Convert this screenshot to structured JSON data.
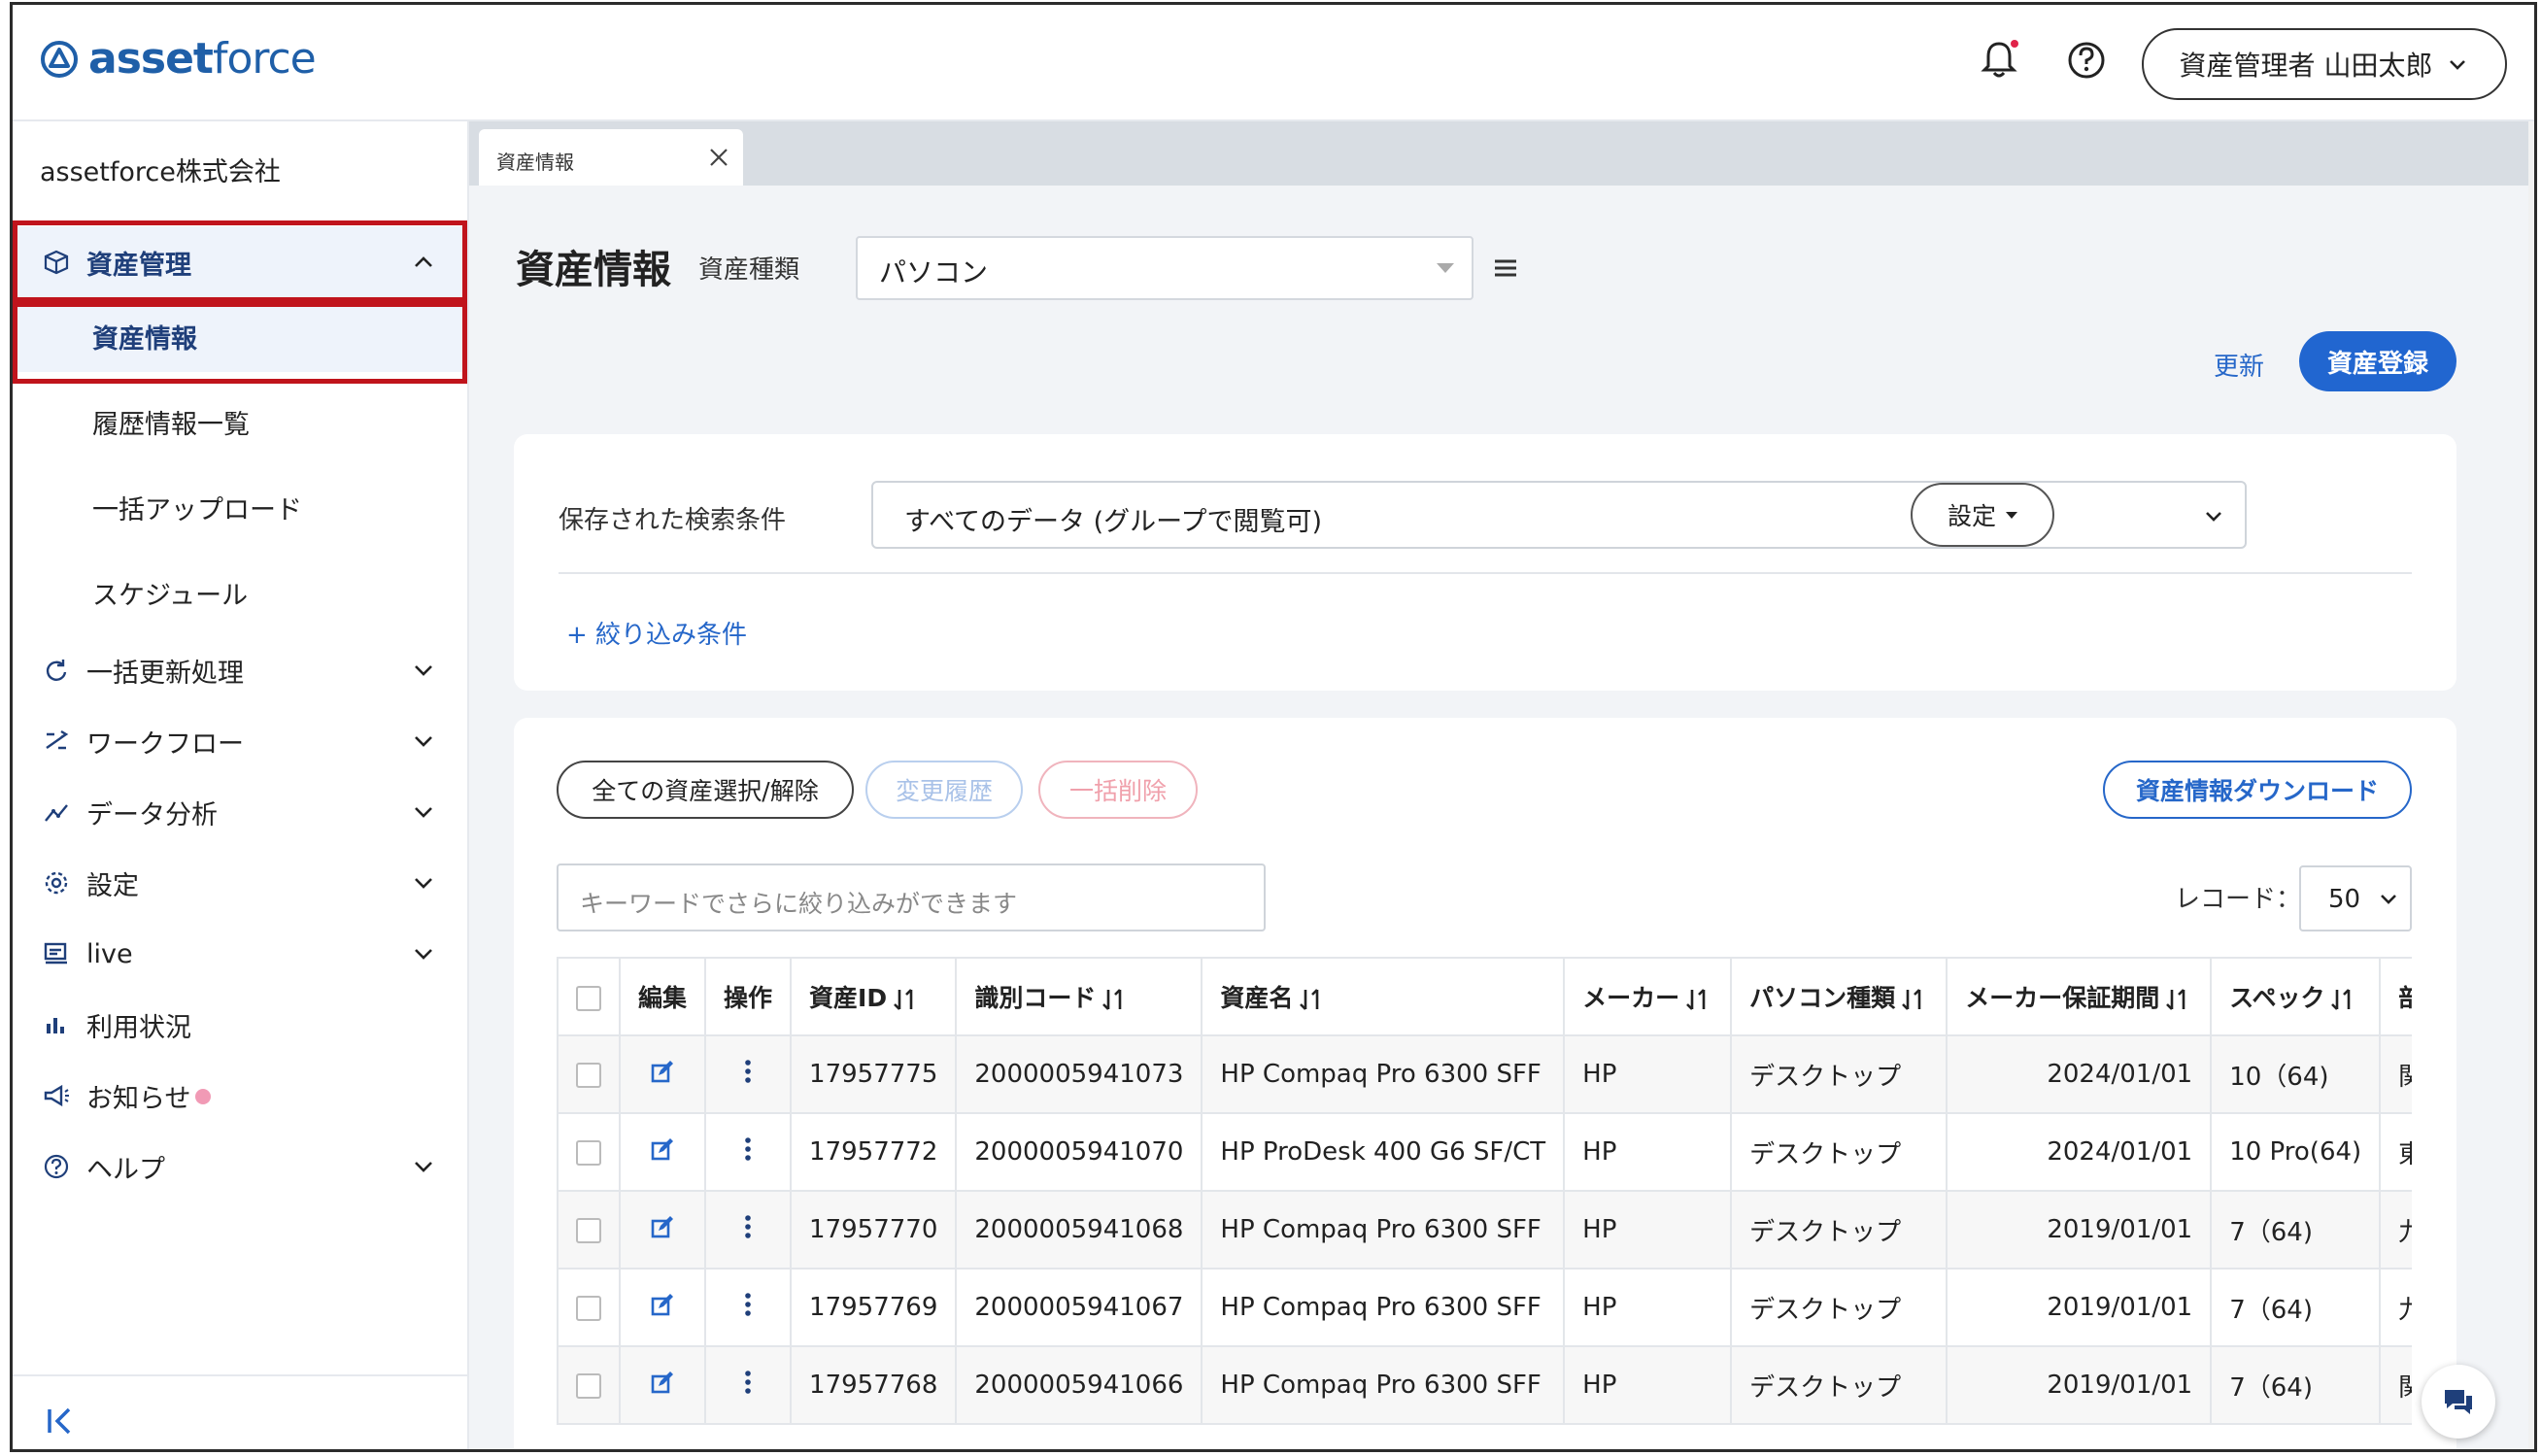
{
  "brand": {
    "logo_text_bold": "asset",
    "logo_text_light": "force",
    "color": "#1f5fa8"
  },
  "header": {
    "user_label": "資産管理者 山田太郎"
  },
  "sidebar": {
    "company": "assetforce株式会社",
    "group_asset": "資産管理",
    "sub_items": [
      "資産情報",
      "履歴情報一覧",
      "一括アップロード",
      "スケジュール"
    ],
    "items": [
      {
        "label": "一括更新処理",
        "icon": "refresh-icon"
      },
      {
        "label": "ワークフロー",
        "icon": "workflow-icon"
      },
      {
        "label": "データ分析",
        "icon": "analytics-icon"
      },
      {
        "label": "設定",
        "icon": "gear-icon"
      },
      {
        "label": "live",
        "icon": "live-icon"
      },
      {
        "label": "利用状況",
        "icon": "bar-chart-icon"
      },
      {
        "label": "お知らせ",
        "icon": "megaphone-icon"
      },
      {
        "label": "ヘルプ",
        "icon": "help-icon"
      }
    ]
  },
  "tabs": [
    {
      "label": "資産情報"
    }
  ],
  "page": {
    "title": "資産情報",
    "type_label": "資産種類",
    "type_value": "パソコン",
    "refresh": "更新",
    "register": "資産登録"
  },
  "search": {
    "saved_label": "保存された検索条件",
    "saved_value": "すべてのデータ (グループで閲覧可)",
    "settings": "設定",
    "filter_link": "+ 絞り込み条件"
  },
  "actions": {
    "select_all": "全ての資産選択/解除",
    "history": "変更履歴",
    "bulk_delete": "一括削除",
    "download": "資産情報ダウンロード",
    "keyword_placeholder": "キーワードでさらに絞り込みができます",
    "record_label": "レコード：",
    "record_value": "50"
  },
  "table": {
    "headers": [
      "",
      "編集",
      "操作",
      "資産ID",
      "識別コード",
      "資産名",
      "メーカー",
      "パソコン種類",
      "メーカー保証期間",
      "スペック",
      "部署"
    ],
    "rows": [
      [
        "17957775",
        "2000005941073",
        "HP Compaq Pro 6300 SFF",
        "HP",
        "デスクトップ",
        "2024/01/01",
        "10（64)",
        "関西"
      ],
      [
        "17957772",
        "2000005941070",
        "HP ProDesk 400 G6 SF/CT",
        "HP",
        "デスクトップ",
        "2024/01/01",
        "10 Pro(64)",
        "東京"
      ],
      [
        "17957770",
        "2000005941068",
        "HP Compaq Pro 6300 SFF",
        "HP",
        "デスクトップ",
        "2019/01/01",
        "7（64)",
        "九州"
      ],
      [
        "17957769",
        "2000005941067",
        "HP Compaq Pro 6300 SFF",
        "HP",
        "デスクトップ",
        "2019/01/01",
        "7（64)",
        "九州"
      ],
      [
        "17957768",
        "2000005941066",
        "HP Compaq Pro 6300 SFF",
        "HP",
        "デスクトップ",
        "2019/01/01",
        "7（64)",
        "関西"
      ]
    ]
  },
  "colors": {
    "accent": "#2166d0",
    "highlight_border": "#c0141c"
  }
}
